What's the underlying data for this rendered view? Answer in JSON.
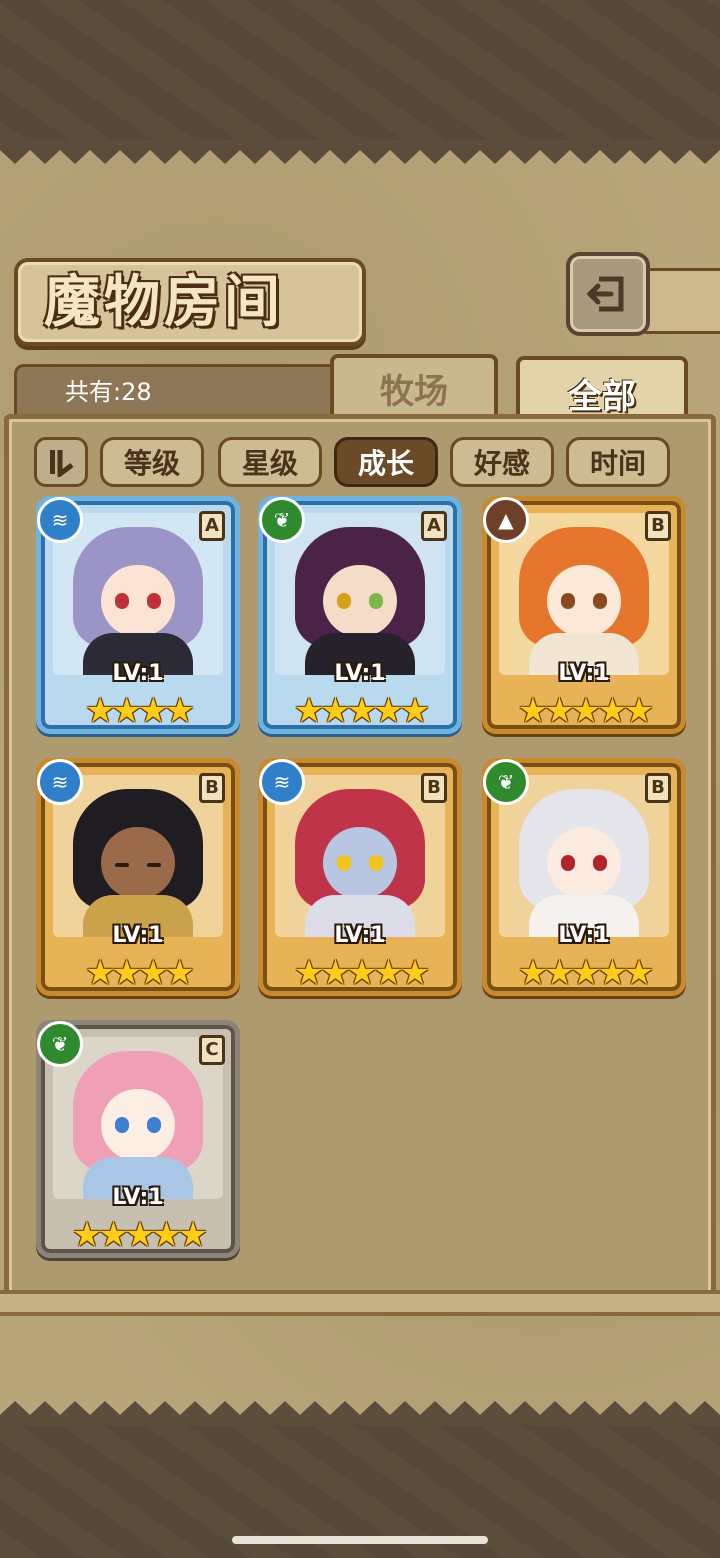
{
  "header": {
    "title": "魔物房间"
  },
  "inventory": {
    "count_label": "共有:28"
  },
  "tabs": [
    {
      "label": "牧场",
      "active": false
    },
    {
      "label": "全部",
      "active": true
    }
  ],
  "sort": {
    "buttons": [
      {
        "label": "等级",
        "active": false
      },
      {
        "label": "星级",
        "active": false
      },
      {
        "label": "成长",
        "active": true
      },
      {
        "label": "好感",
        "active": false
      },
      {
        "label": "时间",
        "active": false
      }
    ]
  },
  "monsters": [
    {
      "level": "LV:1",
      "stars": "★★★★",
      "rank": "A",
      "element": "water",
      "frame": "blue"
    },
    {
      "level": "LV:1",
      "stars": "★★★★★",
      "rank": "A",
      "element": "grass",
      "frame": "blue"
    },
    {
      "level": "LV:1",
      "stars": "★★★★★",
      "rank": "B",
      "element": "rock",
      "frame": "orange"
    },
    {
      "level": "LV:1",
      "stars": "★★★★",
      "rank": "B",
      "element": "water",
      "frame": "orange"
    },
    {
      "level": "LV:1",
      "stars": "★★★★★",
      "rank": "B",
      "element": "water",
      "frame": "orange"
    },
    {
      "level": "LV:1",
      "stars": "★★★★★",
      "rank": "B",
      "element": "grass",
      "frame": "orange"
    },
    {
      "level": "LV:1",
      "stars": "★★★★★",
      "rank": "C",
      "element": "grass",
      "frame": "silver"
    }
  ],
  "icons": {
    "back": "back-arrow-icon",
    "sort_order": "sort-order-icon",
    "element_water": "water-element-icon",
    "element_grass": "leaf-element-icon",
    "element_rock": "rock-element-icon"
  },
  "colors": {
    "star": "#ffcc1a",
    "frame_blue": "#6fb3df",
    "frame_orange": "#c88a2e",
    "frame_silver": "#8c8577",
    "active_sort_bg": "#6b4a27"
  }
}
